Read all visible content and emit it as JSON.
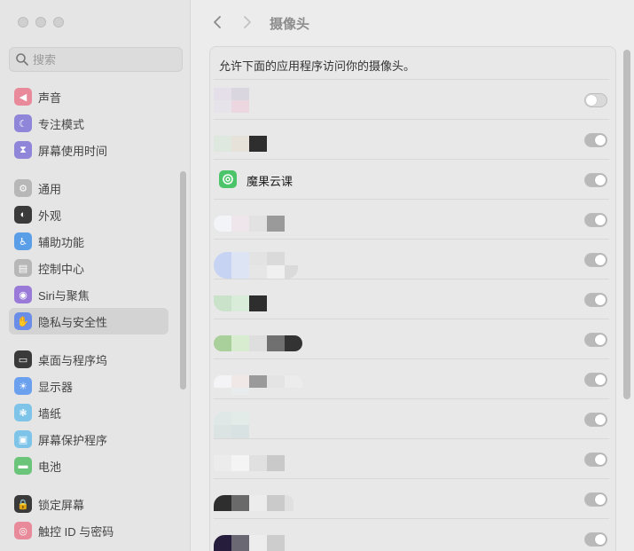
{
  "sidebar": {
    "search_placeholder": "搜索",
    "items": [
      {
        "label": "声音",
        "icon": "speaker-icon",
        "color": "#e88a9a"
      },
      {
        "label": "专注模式",
        "icon": "moon-icon",
        "color": "#8f86d9"
      },
      {
        "label": "屏幕使用时间",
        "icon": "hourglass-icon",
        "color": "#8f86d9"
      },
      {
        "label": "通用",
        "icon": "gear-icon",
        "color": "#b7b7b7"
      },
      {
        "label": "外观",
        "icon": "appearance-icon",
        "color": "#3a3a3a"
      },
      {
        "label": "辅助功能",
        "icon": "accessibility-icon",
        "color": "#5a9ee8"
      },
      {
        "label": "控制中心",
        "icon": "control-center-icon",
        "color": "#b7b7b7"
      },
      {
        "label": "Siri与聚焦",
        "icon": "siri-icon",
        "color": "#9a7ad9"
      },
      {
        "label": "隐私与安全性",
        "icon": "hand-icon",
        "color": "#6a8ee8"
      },
      {
        "label": "桌面与程序坞",
        "icon": "dock-icon",
        "color": "#3a3a3a"
      },
      {
        "label": "显示器",
        "icon": "display-icon",
        "color": "#6aa0ee"
      },
      {
        "label": "墙纸",
        "icon": "wallpaper-icon",
        "color": "#7dc4e8"
      },
      {
        "label": "屏幕保护程序",
        "icon": "screensaver-icon",
        "color": "#7dc4e8"
      },
      {
        "label": "电池",
        "icon": "battery-icon",
        "color": "#6ac47a"
      },
      {
        "label": "锁定屏幕",
        "icon": "lock-icon",
        "color": "#3a3a3a"
      },
      {
        "label": "触控 ID 与密码",
        "icon": "fingerprint-icon",
        "color": "#e88a9a"
      }
    ],
    "active_label": "隐私与安全性"
  },
  "toolbar": {
    "title": "摄像头",
    "back_icon": "chevron-left-icon",
    "forward_icon": "chevron-right-icon"
  },
  "camera": {
    "description": "允许下面的应用程序访问你的摄像头。",
    "apps": [
      {
        "name": "",
        "enabled": false
      },
      {
        "name": "",
        "enabled": true
      },
      {
        "name": "魔果云课",
        "enabled": true
      },
      {
        "name": "",
        "enabled": true
      },
      {
        "name": "",
        "enabled": true
      },
      {
        "name": "",
        "enabled": true
      },
      {
        "name": "",
        "enabled": true
      },
      {
        "name": "",
        "enabled": true
      },
      {
        "name": "",
        "enabled": true
      },
      {
        "name": "",
        "enabled": true
      },
      {
        "name": "",
        "enabled": true
      },
      {
        "name": "",
        "enabled": true
      }
    ]
  }
}
